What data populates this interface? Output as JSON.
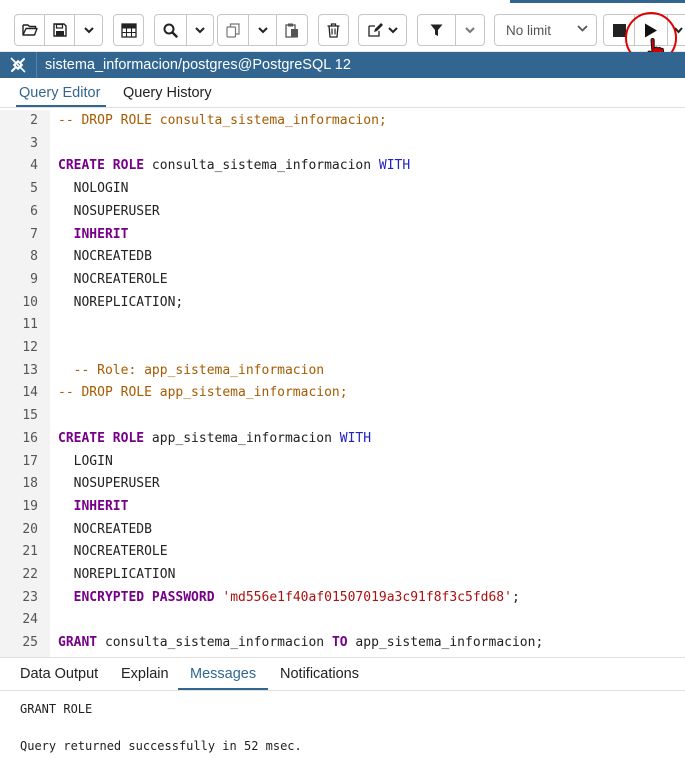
{
  "toolbar": {
    "limit_value": "No limit",
    "icons": [
      "folder-open-icon",
      "save-icon",
      "chevron-down-icon",
      "table-icon",
      "search-icon",
      "chevron-down-icon",
      "copy-icon",
      "chevron-down-icon",
      "paste-icon",
      "delete-icon",
      "edit-icon",
      "chevron-down-icon",
      "filter-icon",
      "chevron-down-icon",
      "stop-icon",
      "play-icon",
      "chevron-down-icon"
    ]
  },
  "connection": {
    "label": "sistema_informacion/postgres@PostgreSQL 12",
    "icon": "connection-icon"
  },
  "editor_tabs": [
    {
      "label": "Query Editor",
      "active": true
    },
    {
      "label": "Query History",
      "active": false
    }
  ],
  "code_lines": [
    {
      "n": "2",
      "tokens": [
        {
          "t": "-- DROP ROLE consulta_sistema_informacion;",
          "c": "com"
        }
      ]
    },
    {
      "n": "3",
      "tokens": []
    },
    {
      "n": "4",
      "tokens": [
        {
          "t": "CREATE ROLE",
          "c": "kw"
        },
        {
          "t": " consulta_sistema_informacion ",
          "c": "plain"
        },
        {
          "t": "WITH",
          "c": "kw2"
        }
      ]
    },
    {
      "n": "5",
      "tokens": [
        {
          "t": "  NOLOGIN",
          "c": "plain"
        }
      ]
    },
    {
      "n": "6",
      "tokens": [
        {
          "t": "  NOSUPERUSER",
          "c": "plain"
        }
      ]
    },
    {
      "n": "7",
      "tokens": [
        {
          "t": "  ",
          "c": "plain"
        },
        {
          "t": "INHERIT",
          "c": "kw"
        }
      ]
    },
    {
      "n": "8",
      "tokens": [
        {
          "t": "  NOCREATEDB",
          "c": "plain"
        }
      ]
    },
    {
      "n": "9",
      "tokens": [
        {
          "t": "  NOCREATEROLE",
          "c": "plain"
        }
      ]
    },
    {
      "n": "10",
      "tokens": [
        {
          "t": "  NOREPLICATION;",
          "c": "plain"
        }
      ]
    },
    {
      "n": "11",
      "tokens": []
    },
    {
      "n": "12",
      "tokens": []
    },
    {
      "n": "13",
      "tokens": [
        {
          "t": "  -- Role: app_sistema_informacion",
          "c": "com"
        }
      ]
    },
    {
      "n": "14",
      "tokens": [
        {
          "t": "-- DROP ROLE app_sistema_informacion;",
          "c": "com"
        }
      ]
    },
    {
      "n": "15",
      "tokens": []
    },
    {
      "n": "16",
      "tokens": [
        {
          "t": "CREATE ROLE",
          "c": "kw"
        },
        {
          "t": " app_sistema_informacion ",
          "c": "plain"
        },
        {
          "t": "WITH",
          "c": "kw2"
        }
      ]
    },
    {
      "n": "17",
      "tokens": [
        {
          "t": "  LOGIN",
          "c": "plain"
        }
      ]
    },
    {
      "n": "18",
      "tokens": [
        {
          "t": "  NOSUPERUSER",
          "c": "plain"
        }
      ]
    },
    {
      "n": "19",
      "tokens": [
        {
          "t": "  ",
          "c": "plain"
        },
        {
          "t": "INHERIT",
          "c": "kw"
        }
      ]
    },
    {
      "n": "20",
      "tokens": [
        {
          "t": "  NOCREATEDB",
          "c": "plain"
        }
      ]
    },
    {
      "n": "21",
      "tokens": [
        {
          "t": "  NOCREATEROLE",
          "c": "plain"
        }
      ]
    },
    {
      "n": "22",
      "tokens": [
        {
          "t": "  NOREPLICATION",
          "c": "plain"
        }
      ]
    },
    {
      "n": "23",
      "tokens": [
        {
          "t": "  ",
          "c": "plain"
        },
        {
          "t": "ENCRYPTED PASSWORD",
          "c": "kw"
        },
        {
          "t": " ",
          "c": "plain"
        },
        {
          "t": "'md556e1f40af01507019a3c91f8f3c5fd68'",
          "c": "str"
        },
        {
          "t": ";",
          "c": "plain"
        }
      ]
    },
    {
      "n": "24",
      "tokens": []
    },
    {
      "n": "25",
      "tokens": [
        {
          "t": "GRANT",
          "c": "kw"
        },
        {
          "t": " consulta_sistema_informacion ",
          "c": "plain"
        },
        {
          "t": "TO",
          "c": "kw"
        },
        {
          "t": " app_sistema_informacion;",
          "c": "plain"
        }
      ]
    }
  ],
  "output_tabs": [
    {
      "label": "Data Output",
      "active": false
    },
    {
      "label": "Explain",
      "active": false
    },
    {
      "label": "Messages",
      "active": true
    },
    {
      "label": "Notifications",
      "active": false
    }
  ],
  "messages": {
    "line1": "GRANT ROLE",
    "line2": "Query returned successfully in 52 msec."
  },
  "colors": {
    "accent": "#326690",
    "highlight_circle": "#e00000"
  }
}
